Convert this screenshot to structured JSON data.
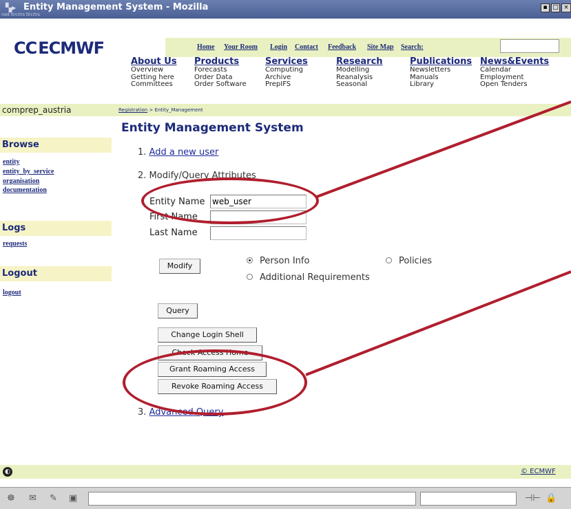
{
  "window": {
    "title": "Entity Management System - Mozilla",
    "subtitle": "root ltrcrtrs ltrcrtrs"
  },
  "header": {
    "logo": "ECMWF",
    "toplinks": [
      "Home",
      "Your Room",
      "Login",
      "Contact",
      "Feedback",
      "Site Map",
      "Search:"
    ],
    "search": {
      "value": ""
    },
    "menu": [
      {
        "heading": "About Us",
        "items": [
          "Overview",
          "Getting here",
          "Committees"
        ]
      },
      {
        "heading": "Products",
        "items": [
          "Forecasts",
          "Order Data",
          "Order Software"
        ]
      },
      {
        "heading": "Services",
        "items": [
          "Computing",
          "Archive",
          "PrepIFS"
        ]
      },
      {
        "heading": "Research",
        "items": [
          "Modelling",
          "Reanalysis",
          "Seasonal"
        ]
      },
      {
        "heading": "Publications",
        "items": [
          "Newsletters",
          "Manuals",
          "Library"
        ]
      },
      {
        "heading": "News&Events",
        "items": [
          "Calendar",
          "Employment",
          "Open Tenders"
        ]
      }
    ]
  },
  "crumbbar": {
    "user": "comprep_austria",
    "crumb_link": "Registration",
    "crumb_rest": " > Entity_Management"
  },
  "sidebar": {
    "browse": {
      "heading": "Browse",
      "links": [
        "entity",
        "entity_by_service",
        "organisation",
        "documentation"
      ]
    },
    "logs": {
      "heading": "Logs",
      "links": [
        "requests"
      ]
    },
    "logout": {
      "heading": "Logout",
      "links": [
        "logout"
      ]
    }
  },
  "main": {
    "title": "Entity Management System",
    "step1": {
      "num": "1.",
      "link": "Add a new user"
    },
    "step2": {
      "num": "2.",
      "text": "Modify/Query Attributes"
    },
    "step3": {
      "num": "3.",
      "link": "Advanced Query"
    },
    "fields": {
      "entity_name": {
        "label": "Entity Name",
        "value": "web_user"
      },
      "first_name": {
        "label": "First Name",
        "value": ""
      },
      "last_name": {
        "label": "Last Name",
        "value": ""
      }
    },
    "radios": {
      "person_info": {
        "label": "Person Info",
        "checked": true
      },
      "policies": {
        "label": "Policies",
        "checked": false
      },
      "additional": {
        "label": "Additional Requirements",
        "checked": false
      }
    },
    "buttons": {
      "modify": "Modify",
      "query": "Query",
      "change_shell": "Change Login Shell",
      "check_home": "Check Access Home",
      "grant_roaming": "Grant Roaming Access",
      "revoke_roaming": "Revoke Roaming Access"
    }
  },
  "footer": {
    "copyright": "© ECMWF"
  },
  "annotation_color": "#b01e2e"
}
